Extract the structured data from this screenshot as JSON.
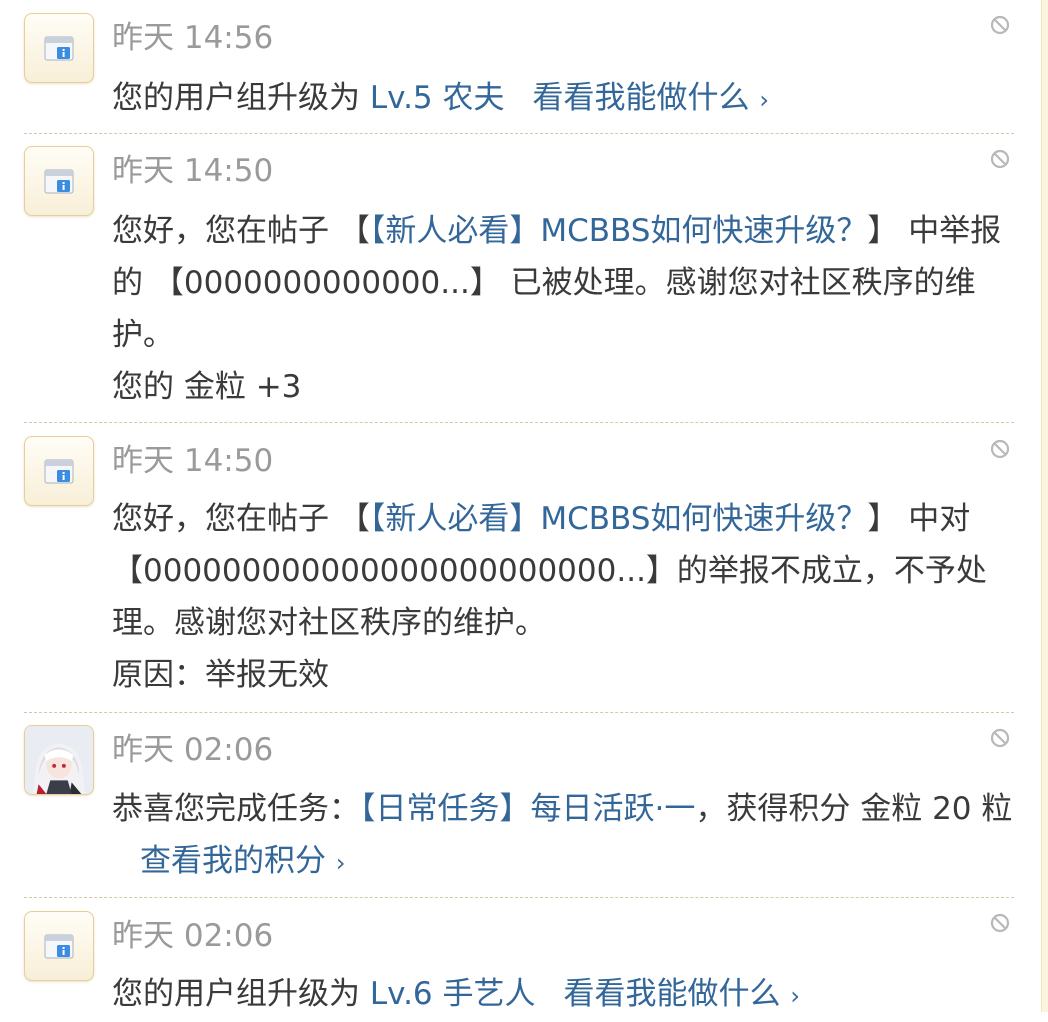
{
  "colors": {
    "link": "#336699",
    "text": "#3a3a3a",
    "muted": "#9a9a9a",
    "divider": "#d2c8ac",
    "avatar_border": "#e5cf97",
    "side_strip": "#fbf4df"
  },
  "icons": {
    "system": "notice-info-icon",
    "delete": "delete-icon",
    "chevron": "chevron-right-icon"
  },
  "notices": [
    {
      "time": "昨天 14:56",
      "text_before": "您的用户组升级为 ",
      "group_link": "Lv.5 农夫",
      "action_link": "看看我能做什么",
      "chevron": "›"
    },
    {
      "time": "昨天 14:50",
      "t1": "您好，您在帖子 【",
      "thread_link": "【新人必看】MCBBS如何快速升级？",
      "t2": "】 中举报的 【0000000000000...】 已被处理。感谢您对社区秩序的维护。",
      "line2": "您的 金粒 +3"
    },
    {
      "time": "昨天 14:50",
      "t1": "您好，您在帖子 【",
      "thread_link": "【新人必看】MCBBS如何快速升级？",
      "t2": "】 中对 【000000000000000000000000...】的举报不成立，不予处理。感谢您对社区秩序的维护。",
      "line2": "原因：举报无效"
    },
    {
      "time": "昨天 02:06",
      "t1": "恭喜您完成任务：",
      "task_link": "【日常任务】每日活跃·一",
      "t2": "，获得积分 金粒 20 粒",
      "action_link": "查看我的积分",
      "chevron": "›"
    },
    {
      "time": "昨天 02:06",
      "text_before": "您的用户组升级为 ",
      "group_link": "Lv.6 手艺人",
      "action_link": "看看我能做什么",
      "chevron": "›"
    }
  ]
}
